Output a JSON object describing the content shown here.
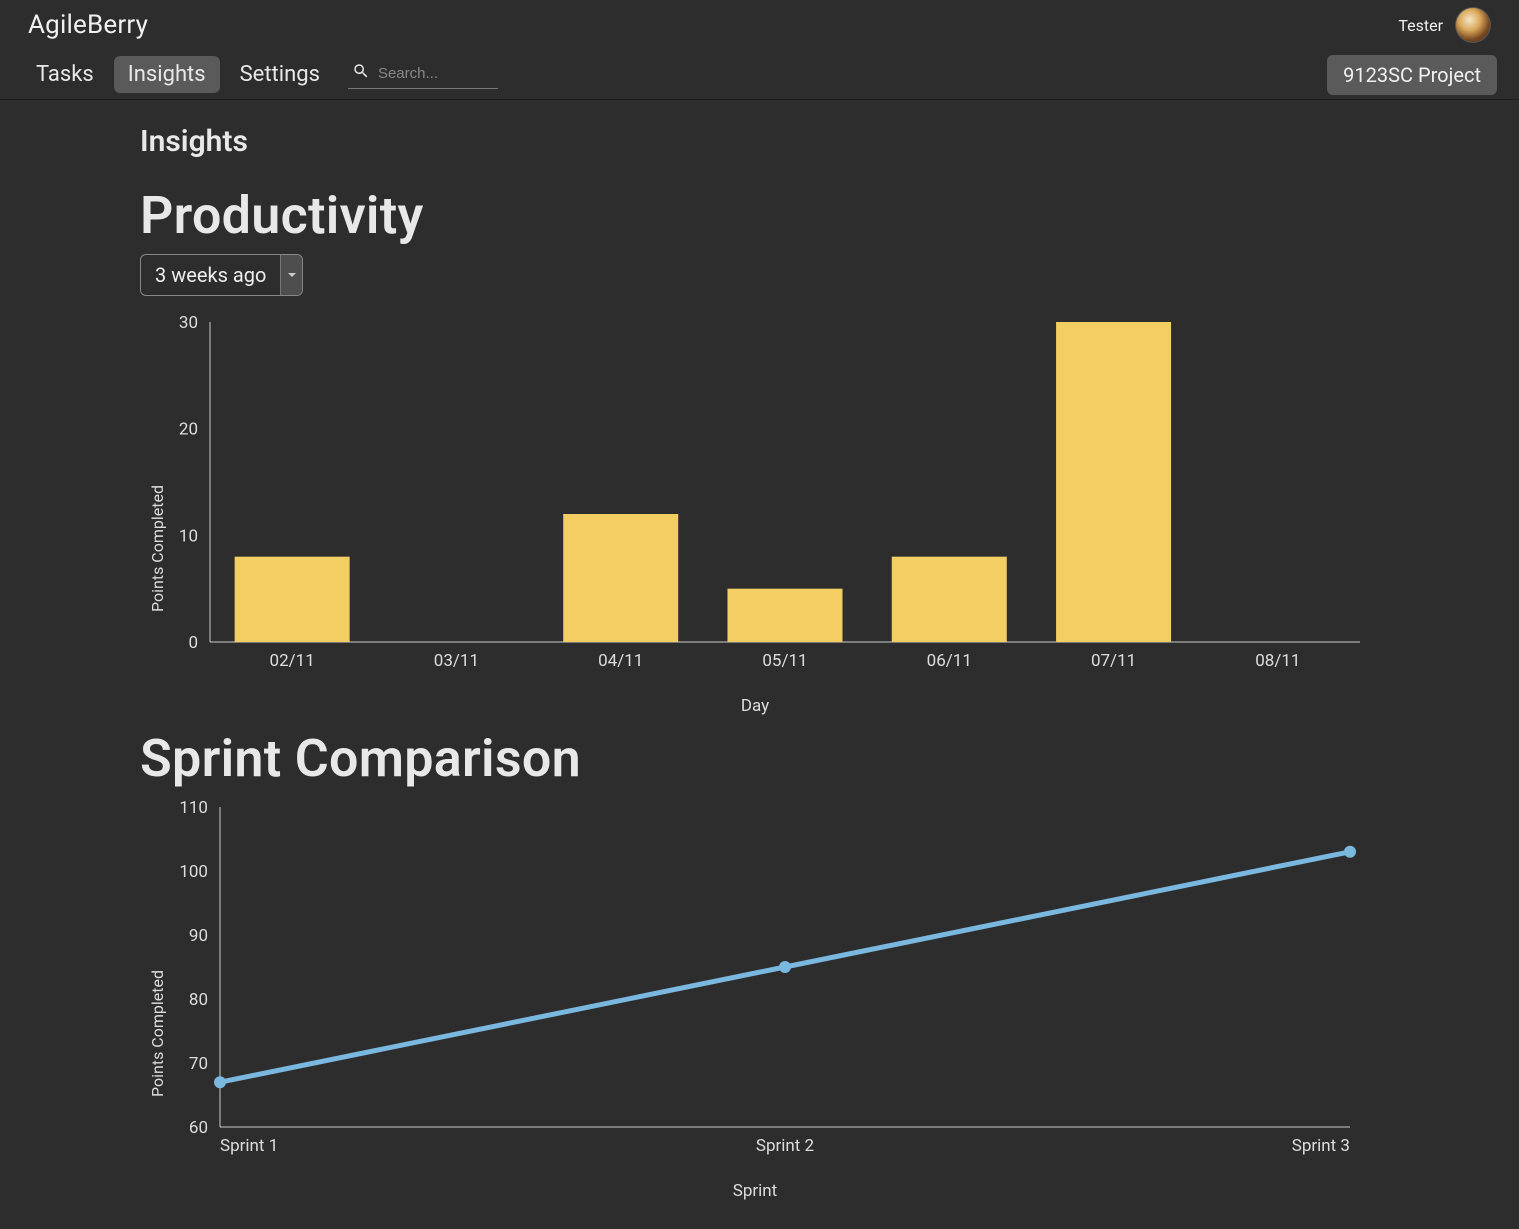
{
  "header": {
    "brand": "AgileBerry",
    "username": "Tester"
  },
  "nav": {
    "items": [
      "Tasks",
      "Insights",
      "Settings"
    ],
    "active": "Insights",
    "search_placeholder": "Search...",
    "project": "9123SC Project"
  },
  "page": {
    "title": "Insights"
  },
  "productivity": {
    "title": "Productivity",
    "range_selected": "3 weeks ago",
    "ylabel": "Points Completed",
    "xlabel": "Day"
  },
  "sprint": {
    "title": "Sprint Comparison",
    "ylabel": "Points Completed",
    "xlabel": "Sprint"
  },
  "chart_data": [
    {
      "type": "bar",
      "title": "Productivity",
      "xlabel": "Day",
      "ylabel": "Points Completed",
      "categories": [
        "02/11",
        "03/11",
        "04/11",
        "05/11",
        "06/11",
        "07/11",
        "08/11"
      ],
      "values": [
        8,
        0,
        12,
        5,
        8,
        30,
        0
      ],
      "ylim": [
        0,
        30
      ],
      "yticks": [
        0,
        10,
        20,
        30
      ]
    },
    {
      "type": "line",
      "title": "Sprint Comparison",
      "xlabel": "Sprint",
      "ylabel": "Points Completed",
      "categories": [
        "Sprint 1",
        "Sprint 2",
        "Sprint 3"
      ],
      "values": [
        67,
        85,
        103
      ],
      "ylim": [
        60,
        110
      ],
      "yticks": [
        60,
        70,
        80,
        90,
        100,
        110
      ]
    }
  ]
}
